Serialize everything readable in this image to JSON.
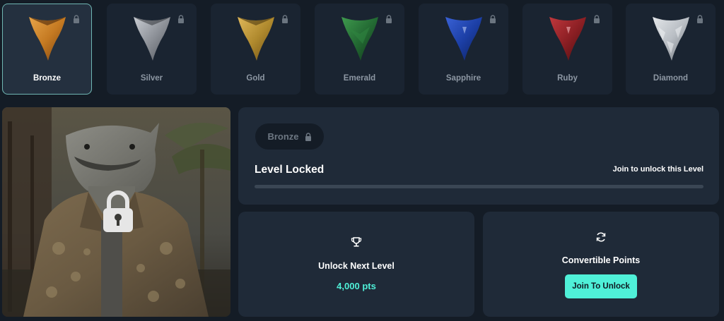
{
  "tiers": [
    {
      "label": "Bronze",
      "active": true,
      "color": "#c9822a",
      "locked": true
    },
    {
      "label": "Silver",
      "active": false,
      "color": "#8b8f96",
      "locked": true
    },
    {
      "label": "Gold",
      "active": false,
      "color": "#b48a2c",
      "locked": true
    },
    {
      "label": "Emerald",
      "active": false,
      "color": "#236a33",
      "locked": true
    },
    {
      "label": "Sapphire",
      "active": false,
      "color": "#1c3fa6",
      "locked": true
    },
    {
      "label": "Ruby",
      "active": false,
      "color": "#8c1f24",
      "locked": true
    },
    {
      "label": "Diamond",
      "active": false,
      "color": "#b9bec4",
      "locked": true
    }
  ],
  "hero": {
    "image": "shark-character-in-floral-shirt",
    "overlay_icon": "padlock-icon"
  },
  "level": {
    "badge_label": "Bronze",
    "title": "Level Locked",
    "join_text": "Join to unlock this Level",
    "progress_fraction": 0
  },
  "next_level": {
    "icon": "trophy-icon",
    "title": "Unlock Next Level",
    "points": "4,000 pts"
  },
  "convertible": {
    "icon": "refresh-icon",
    "title": "Convertible Points",
    "button_label": "Join To Unlock"
  },
  "colors": {
    "accent": "#4ff0d8",
    "background": "#141c26",
    "card": "#1f2a38",
    "active_border": "#6fb6b3"
  }
}
